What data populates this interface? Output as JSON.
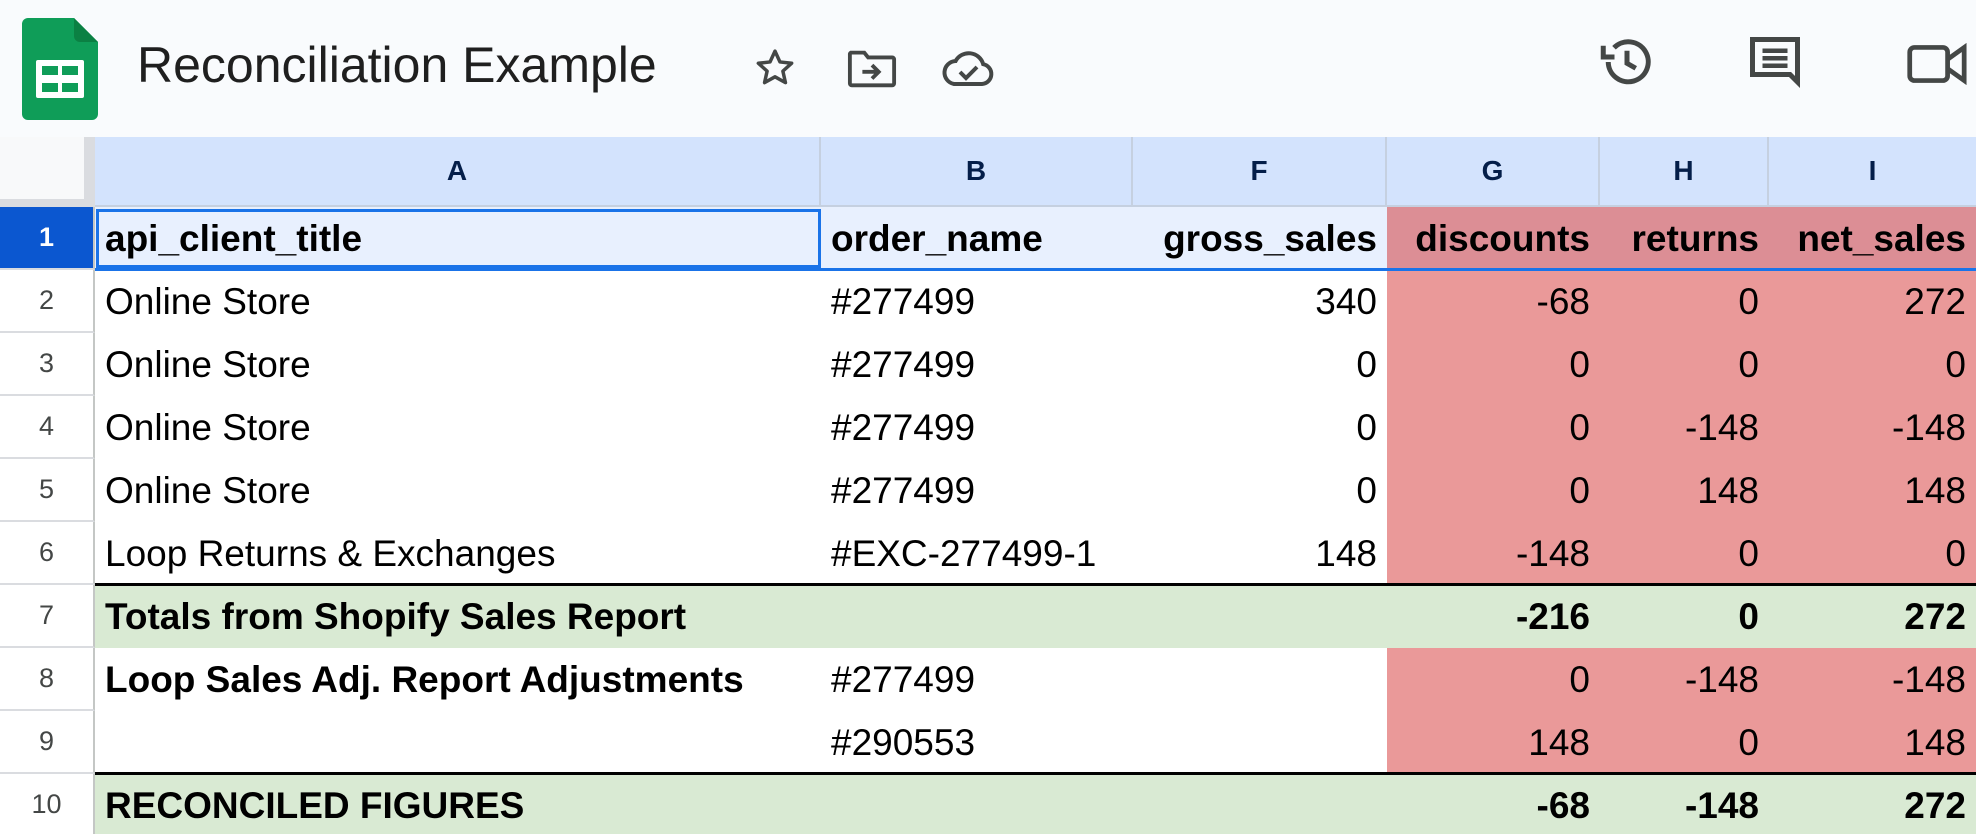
{
  "document": {
    "title": "Reconciliation Example"
  },
  "toolbar_icons": [
    "star-icon",
    "move-folder-icon",
    "cloud-saved-icon",
    "history-icon",
    "comments-icon",
    "meet-icon"
  ],
  "colors": {
    "header_row": "#e8f0fe",
    "header_red": "#dc8e95",
    "data_red": "#ea9999",
    "total_green": "#d9ead3",
    "selection_blue": "#1a73e8",
    "column_header": "#d3e3fd"
  },
  "column_headers": [
    "A",
    "B",
    "F",
    "G",
    "H",
    "I"
  ],
  "row_numbers": [
    "1",
    "2",
    "3",
    "4",
    "5",
    "6",
    "7",
    "8",
    "9",
    "10"
  ],
  "rows": [
    [
      "api_client_title",
      "order_name",
      "gross_sales",
      "discounts",
      "returns",
      "net_sales"
    ],
    [
      "Online Store",
      "#277499",
      "340",
      "-68",
      "0",
      "272"
    ],
    [
      "Online Store",
      "#277499",
      "0",
      "0",
      "0",
      "0"
    ],
    [
      "Online Store",
      "#277499",
      "0",
      "0",
      "-148",
      "-148"
    ],
    [
      "Online Store",
      "#277499",
      "0",
      "0",
      "148",
      "148"
    ],
    [
      "Loop Returns & Exchanges",
      "#EXC-277499-1",
      "148",
      "-148",
      "0",
      "0"
    ],
    [
      "Totals from Shopify Sales Report",
      "",
      "",
      "-216",
      "0",
      "272"
    ],
    [
      "Loop Sales Adj. Report Adjustments",
      "#277499",
      "",
      "0",
      "-148",
      "-148"
    ],
    [
      "",
      "#290553",
      "",
      "148",
      "0",
      "148"
    ],
    [
      "RECONCILED FIGURES",
      "",
      "",
      "-68",
      "-148",
      "272"
    ]
  ]
}
